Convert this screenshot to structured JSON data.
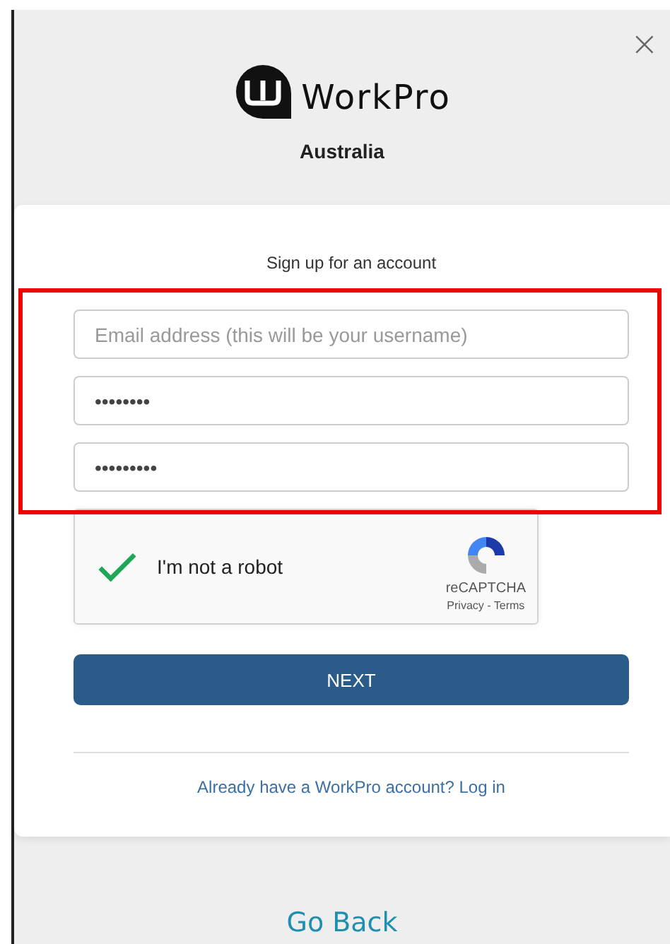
{
  "close_button": {
    "label": "×"
  },
  "header": {
    "logo_text": "WorkPro",
    "region": "Australia"
  },
  "form": {
    "title": "Sign up for an account",
    "highlight": {
      "shown": true
    },
    "fields": [
      {
        "kind": "email",
        "placeholder": "Email address (this will be your username)"
      },
      {
        "kind": "password",
        "value": "••••••••"
      },
      {
        "kind": "password",
        "value": "•••••••••"
      }
    ],
    "captcha": {
      "label": "I'm not a robot",
      "checked": true,
      "brand": "reCAPTCHA",
      "links": "Privacy - Terms"
    },
    "submit": {
      "label": "NEXT"
    },
    "login_link": {
      "label": "Already have a WorkPro account? Log in"
    }
  },
  "go_back": {
    "label": "Go Back"
  }
}
